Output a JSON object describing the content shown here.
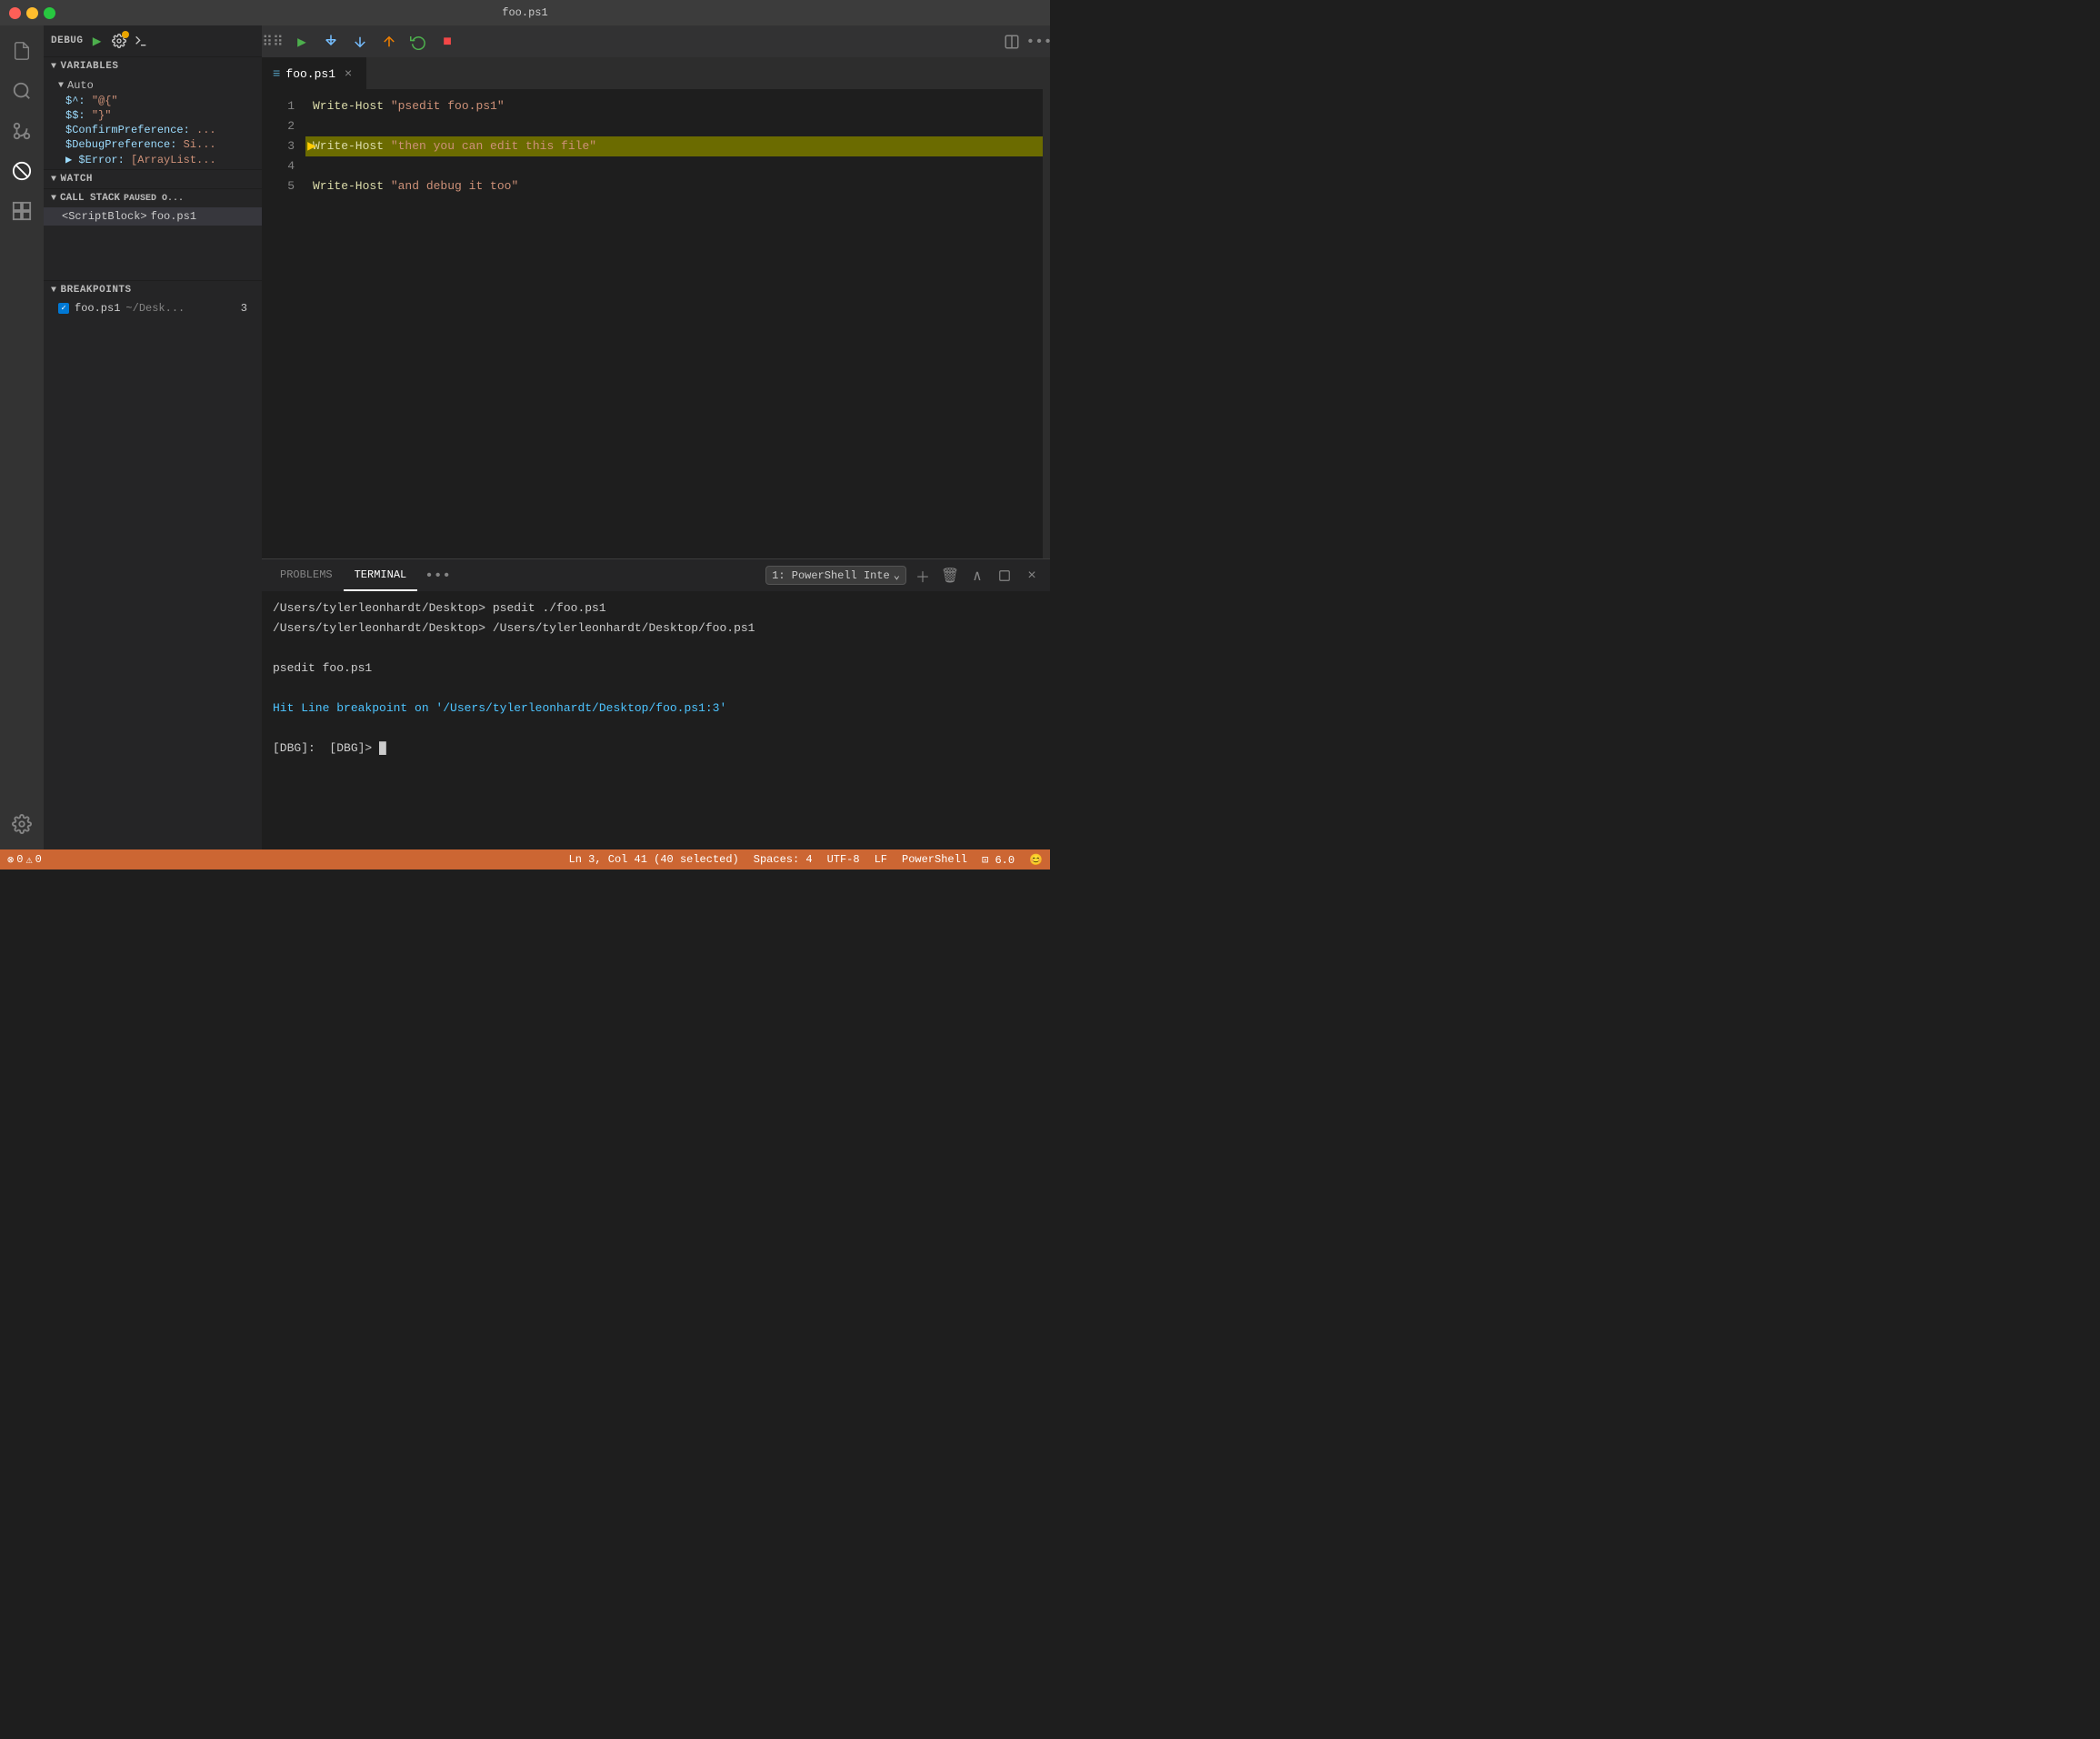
{
  "titleBar": {
    "title": "foo.ps1"
  },
  "activityBar": {
    "icons": [
      {
        "name": "explorer-icon",
        "symbol": "📄",
        "active": false
      },
      {
        "name": "search-icon",
        "symbol": "🔍",
        "active": false
      },
      {
        "name": "git-icon",
        "symbol": "⎇",
        "active": false
      },
      {
        "name": "debug-icon",
        "symbol": "🚫",
        "active": true
      },
      {
        "name": "extensions-icon",
        "symbol": "⊞",
        "active": false
      }
    ]
  },
  "sidebar": {
    "debugLabel": "DEBUG",
    "variablesHeader": "VARIABLES",
    "autoHeader": "Auto",
    "variables": [
      {
        "name": "$^:",
        "value": "\"@{\"",
        "id": "var-caret"
      },
      {
        "name": "$$:",
        "value": "\"}\"",
        "id": "var-dollar"
      },
      {
        "name": "$ConfirmPreference:",
        "value": "...",
        "id": "var-confirm"
      },
      {
        "name": "$DebugPreference:",
        "value": "Si...",
        "id": "var-debug"
      },
      {
        "name": "▶ $Error:",
        "value": "[ArrayList...",
        "id": "var-error"
      }
    ],
    "watchHeader": "WATCH",
    "callStackHeader": "CALL STACK",
    "pausedLabel": "PAUSED O...",
    "callStackItems": [
      {
        "name": "<ScriptBlock>",
        "file": "foo.ps1"
      }
    ],
    "breakpointsHeader": "BREAKPOINTS",
    "breakpoints": [
      {
        "filename": "foo.ps1",
        "path": "~/Desk...",
        "line": "3",
        "checked": true
      }
    ]
  },
  "editor": {
    "tabName": "foo.ps1",
    "lines": [
      {
        "num": 1,
        "code": "Write-Host \"psedit foo.ps1\"",
        "highlighted": false,
        "breakpoint": false,
        "arrow": false
      },
      {
        "num": 2,
        "code": "",
        "highlighted": false,
        "breakpoint": false,
        "arrow": false
      },
      {
        "num": 3,
        "code": "Write-Host \"then you can edit this file\"",
        "highlighted": true,
        "breakpoint": true,
        "arrow": true
      },
      {
        "num": 4,
        "code": "",
        "highlighted": false,
        "breakpoint": false,
        "arrow": false
      },
      {
        "num": 5,
        "code": "Write-Host \"and debug it too\"",
        "highlighted": false,
        "breakpoint": false,
        "arrow": false
      }
    ]
  },
  "debugToolbar": {
    "continue": "▶",
    "stepOver": "↷",
    "stepInto": "↓",
    "stepOut": "↑",
    "restart": "↺",
    "stop": "■"
  },
  "panel": {
    "tabs": [
      {
        "label": "PROBLEMS",
        "active": false
      },
      {
        "label": "TERMINAL",
        "active": true
      }
    ],
    "terminalSelector": "1: PowerShell Inte",
    "terminalContent": [
      {
        "text": "/Users/tylerleonhardt/Desktop> psedit ./foo.ps1",
        "class": "term-prompt"
      },
      {
        "text": "/Users/tylerleonhardt/Desktop> /Users/tylerleonhardt/Desktop/foo.ps1",
        "class": "term-prompt"
      },
      {
        "text": "",
        "class": ""
      },
      {
        "text": "psedit foo.ps1",
        "class": "term-prompt"
      },
      {
        "text": "",
        "class": ""
      },
      {
        "text": "Hit Line breakpoint on '/Users/tylerleonhardt/Desktop/foo.ps1:3'",
        "class": "term-blue"
      },
      {
        "text": "",
        "class": ""
      },
      {
        "text": "[DBG]:  [DBG]> █",
        "class": "term-prompt"
      }
    ]
  },
  "statusBar": {
    "errors": "0",
    "warnings": "0",
    "position": "Ln 3, Col 41 (40 selected)",
    "spaces": "Spaces: 4",
    "encoding": "UTF-8",
    "lineEnding": "LF",
    "language": "PowerShell",
    "extensionVersion": "⊡ 6.0",
    "emoji": "😊"
  }
}
